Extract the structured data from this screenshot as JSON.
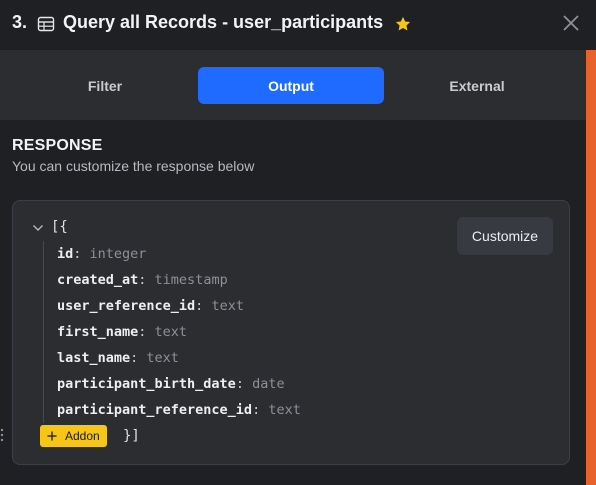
{
  "header": {
    "step_number": "3.",
    "title": "Query all Records - user_participants",
    "accent_color": "#f5c518"
  },
  "tabs": [
    {
      "label": "Filter",
      "active": false
    },
    {
      "label": "Output",
      "active": true
    },
    {
      "label": "External",
      "active": false
    }
  ],
  "response": {
    "title": "RESPONSE",
    "subtitle": "You can customize the response below",
    "open_bracket": "[{",
    "close_bracket": "}]",
    "customize_label": "Customize",
    "addon_label": "Addon",
    "fields": [
      {
        "name": "id",
        "type": "integer"
      },
      {
        "name": "created_at",
        "type": "timestamp"
      },
      {
        "name": "user_reference_id",
        "type": "text"
      },
      {
        "name": "first_name",
        "type": "text"
      },
      {
        "name": "last_name",
        "type": "text"
      },
      {
        "name": "participant_birth_date",
        "type": "date"
      },
      {
        "name": "participant_reference_id",
        "type": "text"
      }
    ]
  },
  "colors": {
    "primary": "#1f6bff",
    "background": "#1e2023",
    "panel": "#2b2d31",
    "scrollbar": "#e8622d"
  }
}
